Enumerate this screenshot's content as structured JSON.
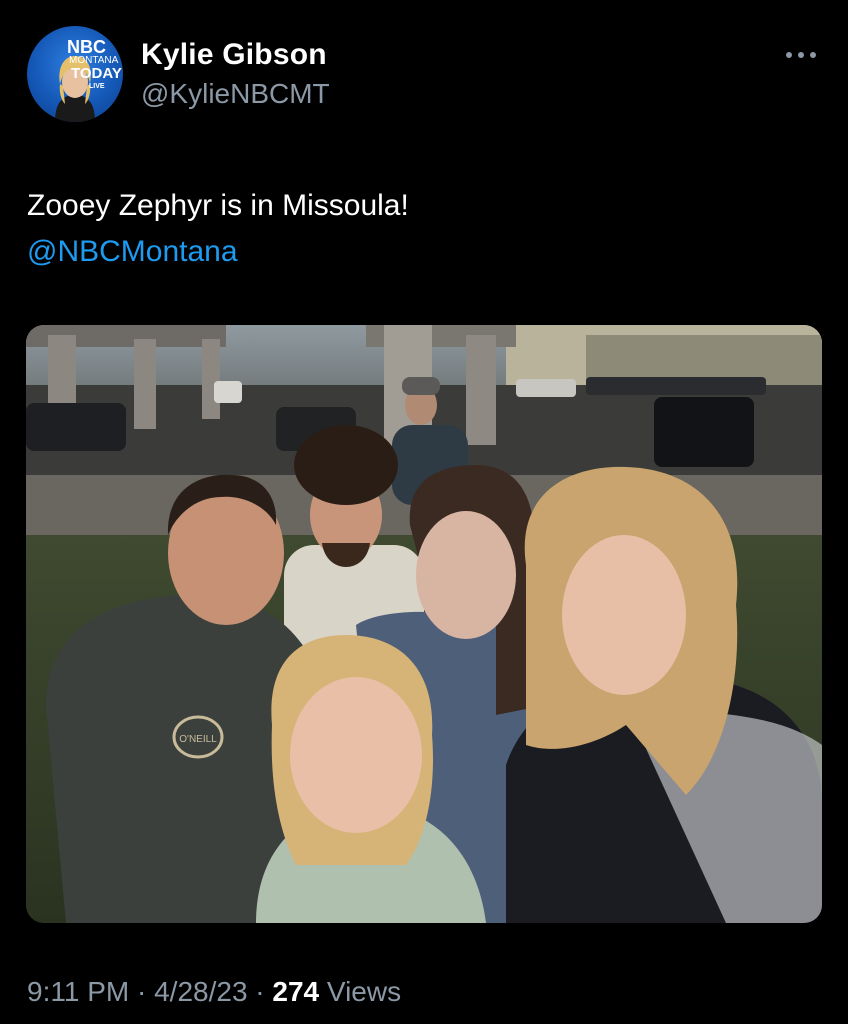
{
  "tweet": {
    "author": {
      "display_name": "Kylie Gibson",
      "handle": "@KylieNBCMT",
      "avatar_logo": {
        "line1": "NBC",
        "line2": "MONTANA",
        "line3": "TODAY",
        "line4": "LIVE"
      }
    },
    "more_icon": "more-horizontal-icon",
    "text": "Zooey Zephyr is in Missoula!",
    "mention": "@NBCMontana",
    "photo": {
      "shirt_logo_text": "O'NEILL"
    },
    "meta": {
      "time": "9:11 PM",
      "separator": "·",
      "date": "4/28/23",
      "views_count": "274",
      "views_label": "Views"
    }
  },
  "colors": {
    "background": "#000000",
    "text_primary": "#ffffff",
    "text_secondary": "#8b98a5",
    "link": "#1d9bf0"
  }
}
